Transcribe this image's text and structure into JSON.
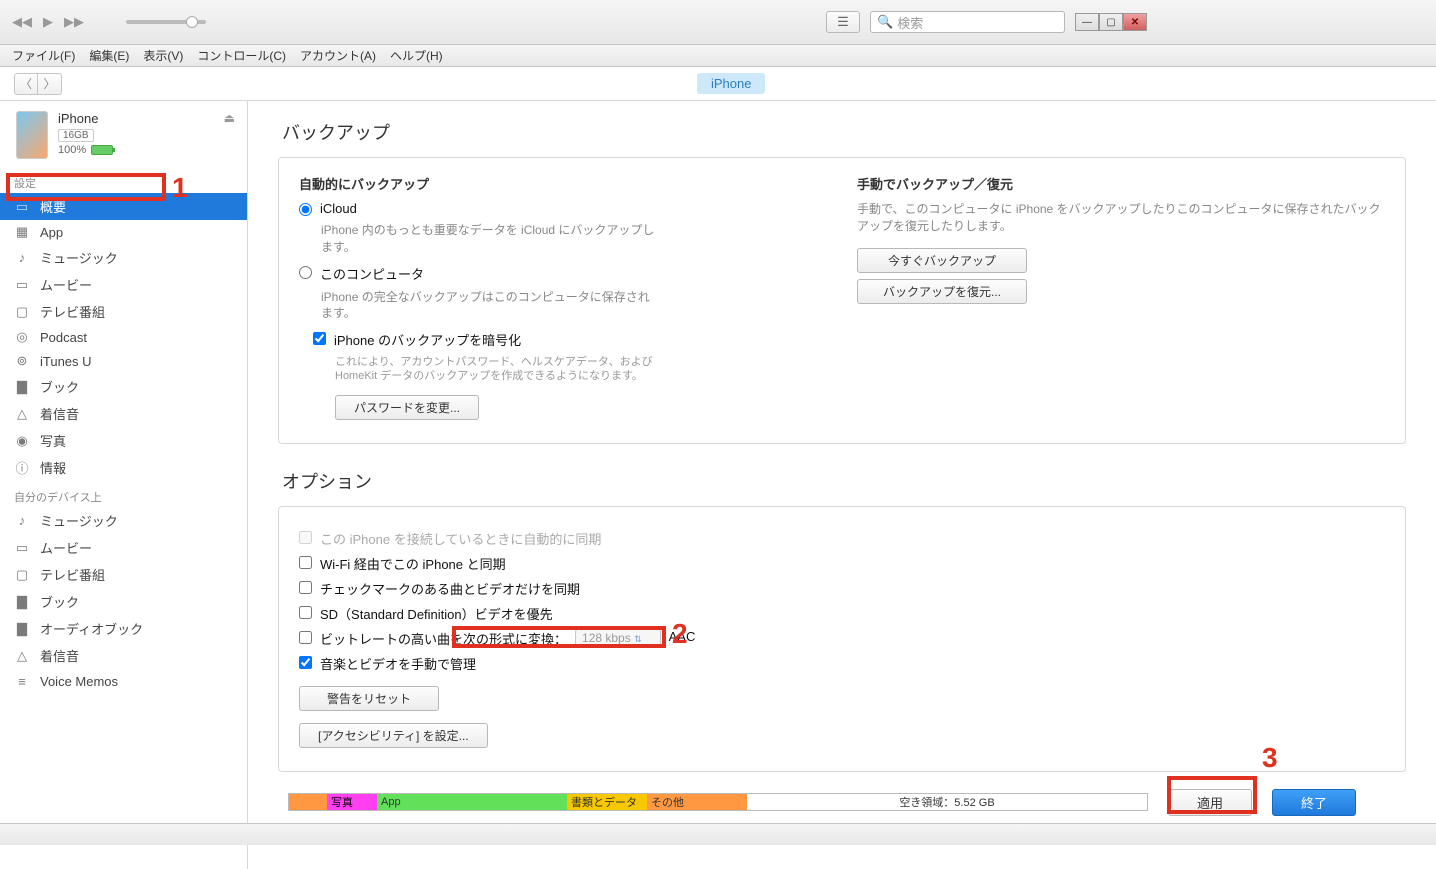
{
  "toolbar": {
    "search_placeholder": "検索"
  },
  "menus": [
    "ファイル(F)",
    "編集(E)",
    "表示(V)",
    "コントロール(C)",
    "アカウント(A)",
    "ヘルプ(H)"
  ],
  "nav": {
    "pill": "iPhone"
  },
  "device": {
    "name": "iPhone",
    "capacity": "16GB",
    "battery_pct": "100%"
  },
  "sidebar": {
    "group1_label": "設定",
    "items1": [
      {
        "label": "概要",
        "icon": "summary"
      },
      {
        "label": "App",
        "icon": "apps"
      },
      {
        "label": "ミュージック",
        "icon": "music"
      },
      {
        "label": "ムービー",
        "icon": "movie"
      },
      {
        "label": "テレビ番組",
        "icon": "tv"
      },
      {
        "label": "Podcast",
        "icon": "podcast"
      },
      {
        "label": "iTunes U",
        "icon": "itunesu"
      },
      {
        "label": "ブック",
        "icon": "book"
      },
      {
        "label": "着信音",
        "icon": "tone"
      },
      {
        "label": "写真",
        "icon": "photo"
      },
      {
        "label": "情報",
        "icon": "info"
      }
    ],
    "group2_label": "自分のデバイス上",
    "items2": [
      {
        "label": "ミュージック",
        "icon": "music"
      },
      {
        "label": "ムービー",
        "icon": "movie"
      },
      {
        "label": "テレビ番組",
        "icon": "tv"
      },
      {
        "label": "ブック",
        "icon": "book"
      },
      {
        "label": "オーディオブック",
        "icon": "audiobook"
      },
      {
        "label": "着信音",
        "icon": "tone"
      },
      {
        "label": "Voice Memos",
        "icon": "voicememo"
      }
    ]
  },
  "backup": {
    "section_title": "バックアップ",
    "auto_head": "自動的にバックアップ",
    "icloud_label": "iCloud",
    "icloud_desc": "iPhone 内のもっとも重要なデータを iCloud にバックアップします。",
    "computer_label": "このコンピュータ",
    "computer_desc": "iPhone の完全なバックアップはこのコンピュータに保存されます。",
    "encrypt_label": "iPhone のバックアップを暗号化",
    "encrypt_desc": "これにより、アカウントパスワード、ヘルスケアデータ、および HomeKit データのバックアップを作成できるようになります。",
    "change_pw_btn": "パスワードを変更...",
    "manual_head": "手動でバックアップ／復元",
    "manual_desc": "手動で、このコンピュータに iPhone をバックアップしたりこのコンピュータに保存されたバックアップを復元したりします。",
    "backup_now_btn": "今すぐバックアップ",
    "restore_btn": "バックアップを復元..."
  },
  "options": {
    "section_title": "オプション",
    "opt1": "この iPhone を接続しているときに自動的に同期",
    "opt2": "Wi-Fi 経由でこの iPhone と同期",
    "opt3": "チェックマークのある曲とビデオだけを同期",
    "opt4": "SD（Standard Definition）ビデオを優先",
    "opt5": "ビットレートの高い曲を次の形式に変換：",
    "bitrate": "128 kbps",
    "codec": "AAC",
    "opt6": "音楽とビデオを手動で管理",
    "reset_warn_btn": "警告をリセット",
    "accessibility_btn": "[アクセシビリティ] を設定..."
  },
  "storage": {
    "photo": "写真",
    "app": "App",
    "docs": "書類とデータ",
    "other": "その他",
    "free": "空き領域：5.52 GB"
  },
  "footer": {
    "apply": "適用",
    "done": "終了"
  },
  "annotations": {
    "n1": "1",
    "n2": "2",
    "n3": "3"
  }
}
